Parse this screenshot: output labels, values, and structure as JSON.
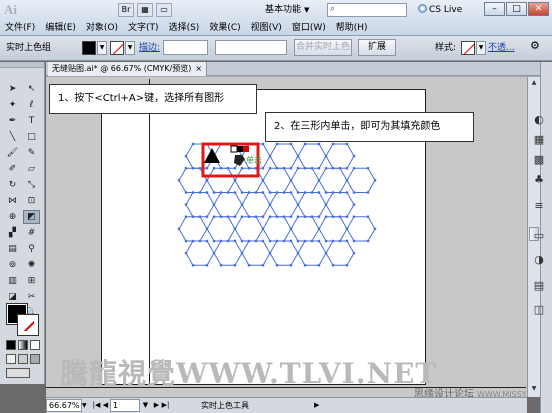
{
  "app": {
    "logo": "Ai",
    "workspace": "基本功能",
    "cslive": "CS Live"
  },
  "menu": [
    "文件(F)",
    "编辑(E)",
    "对象(O)",
    "文字(T)",
    "选择(S)",
    "效果(C)",
    "视图(V)",
    "窗口(W)",
    "帮助(H)"
  ],
  "window_controls": {
    "minimize": "–",
    "maximize": "□",
    "close": "✕"
  },
  "control_bar": {
    "mode_label": "实时上色组",
    "stroke_label": "描边:",
    "merge_button": "合并实时上色",
    "expand_button": "扩展",
    "style_label": "样式:",
    "opacity_label": "不透..."
  },
  "document": {
    "tab_title": "无缝贴图.ai* @ 66.67% (CMYK/预览)",
    "tab_close": "×"
  },
  "callouts": {
    "step1": "1、按下<Ctrl+A>键，选择所有图形",
    "step2": "2、在三形内单击，即可为其填充颜色"
  },
  "cursor_hint": "单击",
  "status": {
    "zoom": "66.67%",
    "page": "1",
    "tool_name": "实时上色工具"
  },
  "watermark": {
    "main": "騰龍視覺WWW.TLVI.NET",
    "site_cn": "思缘设计论坛",
    "site_en": "WWW.MISSYUAN.COM"
  },
  "colors": {
    "pattern_stroke": "#4a6fd6",
    "selection_box": "#e01818",
    "highlight_accent": "#2e9e3a"
  }
}
